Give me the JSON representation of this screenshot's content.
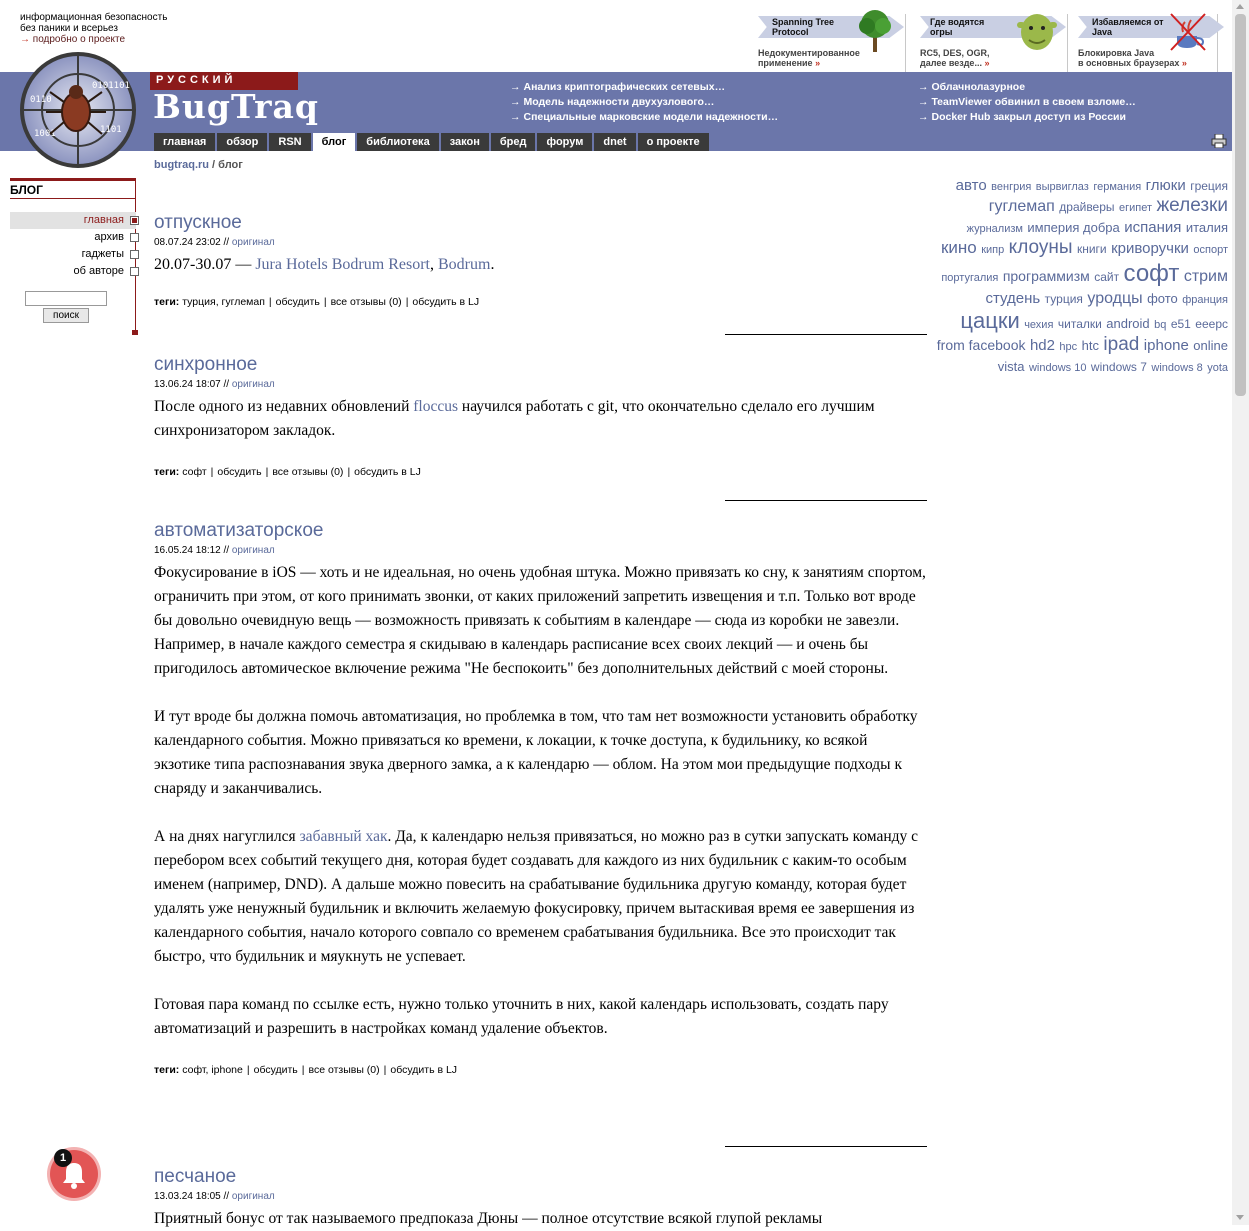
{
  "site": {
    "desc_line1": "информационная безопасность",
    "desc_line2": "без паники и всерьез",
    "about_link": "подробно о проекте",
    "lang": "РУССКИЙ",
    "brand": "BugTraq"
  },
  "promos": [
    {
      "tag": "Spanning Tree Protocol",
      "desc1": "Недокументированное",
      "desc2": "применение",
      "more": "»",
      "icon": "tree-icon"
    },
    {
      "tag": "Где водятся огры",
      "desc1": "RC5, DES, OGR,",
      "desc2": "далее везде...",
      "more": "»",
      "icon": "ogre-icon"
    },
    {
      "tag": "Избавляемся от Java",
      "desc1": "Блокировка Java",
      "desc2": "в основных браузерах",
      "more": "»",
      "icon": "java-crossed-icon"
    }
  ],
  "news_left": [
    "Анализ криптографических сетевых…",
    "Модель надежности двухузлового…",
    "Специальные марковские модели надежности…"
  ],
  "news_right": [
    "Облачнолазурное",
    "TeamViewer обвинил в своем взломе…",
    "Docker Hub закрыл доступ из России"
  ],
  "nav": {
    "tabs": [
      "главная",
      "обзор",
      "RSN",
      "блог",
      "библиотека",
      "закон",
      "бред",
      "форум",
      "dnet",
      "о проекте"
    ],
    "active": "блог"
  },
  "breadcrumb": {
    "home": "bugtraq.ru",
    "sep": " / ",
    "current": "блог"
  },
  "sidebar": {
    "title": "БЛОГ",
    "items": [
      "главная",
      "архив",
      "гаджеты",
      "об авторе"
    ],
    "search_button": "поиск",
    "search_value": ""
  },
  "posts": [
    {
      "title": "отпускное",
      "date": "08.07.24 23:02",
      "orig": "оригинал",
      "body_prefix": "20.07-30.07 — ",
      "body_link1": "Jura Hotels Bodrum Resort",
      "body_sep": ", ",
      "body_link2": "Bodrum",
      "body_suffix": ".",
      "tags": "турция, гуглемап"
    },
    {
      "title": "синхронное",
      "date": "13.06.24 18:07",
      "orig": "оригинал",
      "p1_prefix": "После одного из недавних обновлений ",
      "p1_link": "floccus",
      "p1_suffix": " научился работать с git, что окончательно сделало его лучшим синхронизатором закладок.",
      "tags": "софт"
    },
    {
      "title": "автоматизаторское",
      "date": "16.05.24 18:12",
      "orig": "оригинал",
      "p1": "Фокусирование в iOS — хоть и не идеальная, но очень удобная штука. Можно привязать ко сну, к занятиям спортом, ограничить при этом, от кого принимать звонки, от каких приложений запретить извещения и т.п. Только вот вроде бы довольно очевидную вещь — возможность привязать к событиям в календаре — сюда из коробки не завезли. Например, в начале каждого семестра я скидываю в календарь расписание всех своих лекций — и очень бы пригодилось автомическое включение режима \"Не беспокоить\" без дополнительных действий с моей стороны.",
      "p2": "И тут вроде бы должна помочь автоматизация, но проблемка в том, что там нет возможности установить обработку календарного события. Можно привязаться ко времени, к локации, к точке доступа, к будильнику, ко всякой экзотике типа распознавания звука дверного замка, а к календарю — облом. На этом мои предыдущие подходы к снаряду и заканчивались.",
      "p3_prefix": "А на днях нагуглился ",
      "p3_link": "забавный хак",
      "p3_suffix": ". Да, к календарю нельзя привязаться, но можно раз в сутки запускать команду с перебором всех событий текущего дня, которая будет создавать для каждого из них будильник с каким-то особым именем (например, DND). А дальше можно повесить на срабатывание будильника другую команду, которая будет удалять уже ненужный будильник и включить желаемую фокусировку, причем вытаскивая время ее завершения из календарного события, начало которого совпало со временем срабатывания будильника. Все это происходит так быстро, что будильник и мяукнуть не успевает.",
      "p4": "Готовая пара команд по ссылке есть, нужно только уточнить в них, какой календарь использовать, создать пару автоматизаций и разрешить в настройках команд удаление объектов.",
      "tags": "софт, iphone"
    },
    {
      "title": "песчаное",
      "date": "13.03.24 18:05",
      "orig": "оригинал",
      "p1": "Приятный бонус от так называемого предпоказа Дюны — полное отсутствие всякой глупой рекламы"
    }
  ],
  "post_actions": {
    "tags_label": "теги:",
    "discuss": "обсудить",
    "all_reviews": "все отзывы (0)",
    "discuss_lj": "обсудить в LJ",
    "meta_sep": " // "
  },
  "tag_cloud": [
    [
      "авто",
      15
    ],
    [
      "венгрия",
      11
    ],
    [
      "вырвиглаз",
      11
    ],
    [
      "германия",
      11
    ],
    [
      "глюки",
      15
    ],
    [
      "греция",
      12
    ],
    [
      "гуглемап",
      16
    ],
    [
      "драйверы",
      12
    ],
    [
      "египет",
      11
    ],
    [
      "железки",
      19
    ],
    [
      "журнализм",
      11
    ],
    [
      "империя добра",
      13
    ],
    [
      "испания",
      15
    ],
    [
      "италия",
      13
    ],
    [
      "кино",
      17
    ],
    [
      "кипр",
      11
    ],
    [
      "клоуны",
      19
    ],
    [
      "книги",
      12
    ],
    [
      "криворучки",
      15
    ],
    [
      "оспорт",
      11
    ],
    [
      "португалия",
      11
    ],
    [
      "программизм",
      14
    ],
    [
      "сайт",
      12
    ],
    [
      "софт",
      24
    ],
    [
      "стрим",
      16
    ],
    [
      "студень",
      15
    ],
    [
      "турция",
      12
    ],
    [
      "уродцы",
      16
    ],
    [
      "фото",
      13
    ],
    [
      "франция",
      11
    ],
    [
      "цацки",
      22
    ],
    [
      "чехия",
      11
    ],
    [
      "читалки",
      12
    ],
    [
      "android",
      13
    ],
    [
      "bq",
      11
    ],
    [
      "e51",
      12
    ],
    [
      "eeepc",
      12
    ],
    [
      "from facebook",
      14
    ],
    [
      "hd2",
      15
    ],
    [
      "hpc",
      11
    ],
    [
      "htc",
      13
    ],
    [
      "ipad",
      19
    ],
    [
      "iphone",
      15
    ],
    [
      "online",
      13
    ],
    [
      "vista",
      13
    ],
    [
      "windows 10",
      11
    ],
    [
      "windows 7",
      12
    ],
    [
      "windows 8",
      11
    ],
    [
      "yota",
      11
    ]
  ],
  "notifications": {
    "count": "1"
  }
}
